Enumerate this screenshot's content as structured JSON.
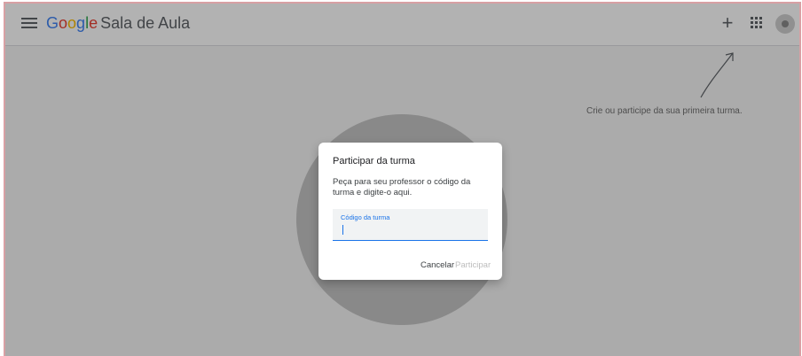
{
  "header": {
    "brand_letters": [
      "G",
      "o",
      "o",
      "g",
      "l",
      "e"
    ],
    "product_name": "Sala de Aula",
    "icons": [
      "menu-icon",
      "plus-icon",
      "apps-grid-icon",
      "account-avatar"
    ],
    "create_symbol": "+"
  },
  "empty_state": {
    "hint": "Crie ou participe da sua primeira turma."
  },
  "dialog": {
    "title": "Participar da turma",
    "description": "Peça para seu professor o código da turma e digite-o aqui.",
    "field_label": "Código da turma",
    "field_value": "",
    "cancel_label": "Cancelar",
    "join_label": "Participar"
  },
  "colors": {
    "accent": "#1a73e8",
    "google_blue": "#4285f4",
    "google_red": "#ea4335",
    "google_yellow": "#fbbc05",
    "google_green": "#34a853",
    "disabled_text": "#bdbdbd"
  }
}
